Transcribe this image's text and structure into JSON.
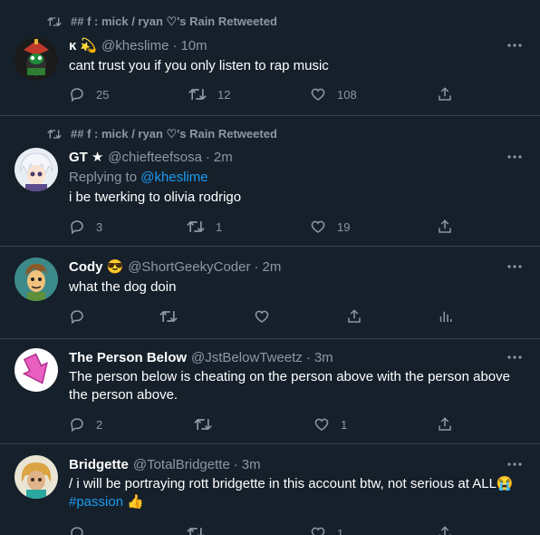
{
  "tweets": [
    {
      "retweet_label": "## f : mick / ryan ♡'s Rain Retweeted",
      "name": "ĸ",
      "badge_emoji": "💫",
      "handle": "@kheslime",
      "dot": "·",
      "time": "10m",
      "text": "cant trust you if you only listen to rap music",
      "reply_count": "25",
      "retweet_count": "12",
      "like_count": "108"
    },
    {
      "retweet_label": "## f : mick / ryan ♡'s Rain Retweeted",
      "name": "GT",
      "badge_emoji": "★",
      "handle": "@chiefteefsosa",
      "dot": "·",
      "time": "2m",
      "replying_to_label": "Replying to",
      "replying_to_handle": "@kheslime",
      "text": "i be twerking to olivia rodrigo",
      "reply_count": "3",
      "retweet_count": "1",
      "like_count": "19"
    },
    {
      "name": "Cody",
      "badge_emoji": "😎",
      "handle": "@ShortGeekyCoder",
      "dot": "·",
      "time": "2m",
      "text": "what the dog doin"
    },
    {
      "name": "The Person Below",
      "handle": "@JstBelowTweetz",
      "dot": "·",
      "time": "3m",
      "text": "The person below is cheating on the person above with the person above the person above.",
      "reply_count": "2",
      "like_count": "1"
    },
    {
      "name": "Bridgette",
      "handle": "@TotalBridgette",
      "dot": "·",
      "time": "3m",
      "text": "/ i will be portraying rott bridgette in this account btw, not serious at ALL😭",
      "hashtag": "#passion",
      "trailing_emoji": "👍",
      "like_count": "1"
    }
  ],
  "colors": {
    "background": "#15202b",
    "divider": "#38444d",
    "secondary_text": "#8b98a5",
    "link": "#1d9bf0"
  },
  "icons": [
    "retweet-icon",
    "more-icon",
    "reply-icon",
    "like-icon",
    "share-icon",
    "analytics-icon"
  ]
}
